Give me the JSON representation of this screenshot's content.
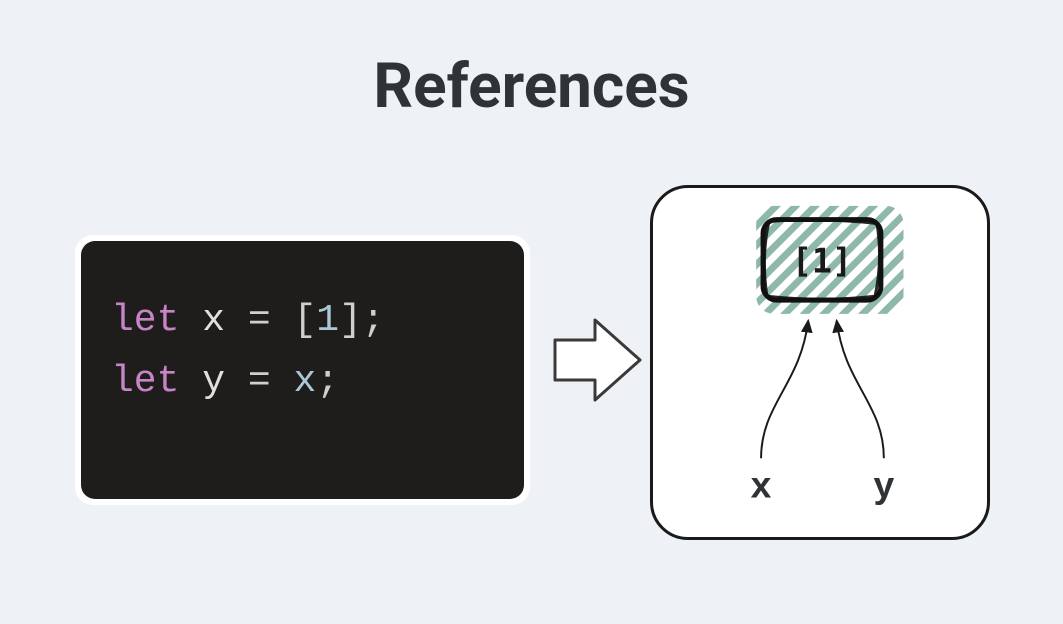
{
  "title": "References",
  "code": {
    "line1": {
      "kw": "let",
      "var": "x",
      "eq": "=",
      "lbracket": "[",
      "num": "1",
      "rbracket": "]",
      "semi": ";"
    },
    "line2": {
      "kw": "let",
      "var": "y",
      "eq": "=",
      "rhs": "x",
      "semi": ";"
    }
  },
  "diagram": {
    "boxValue": "[1]",
    "labelX": "x",
    "labelY": "y"
  },
  "colors": {
    "bg": "#eef1f6",
    "codeBg": "#1f1c1c",
    "keyword": "#c785c8",
    "text": "#303336",
    "hatch": "#8fb8ad"
  }
}
